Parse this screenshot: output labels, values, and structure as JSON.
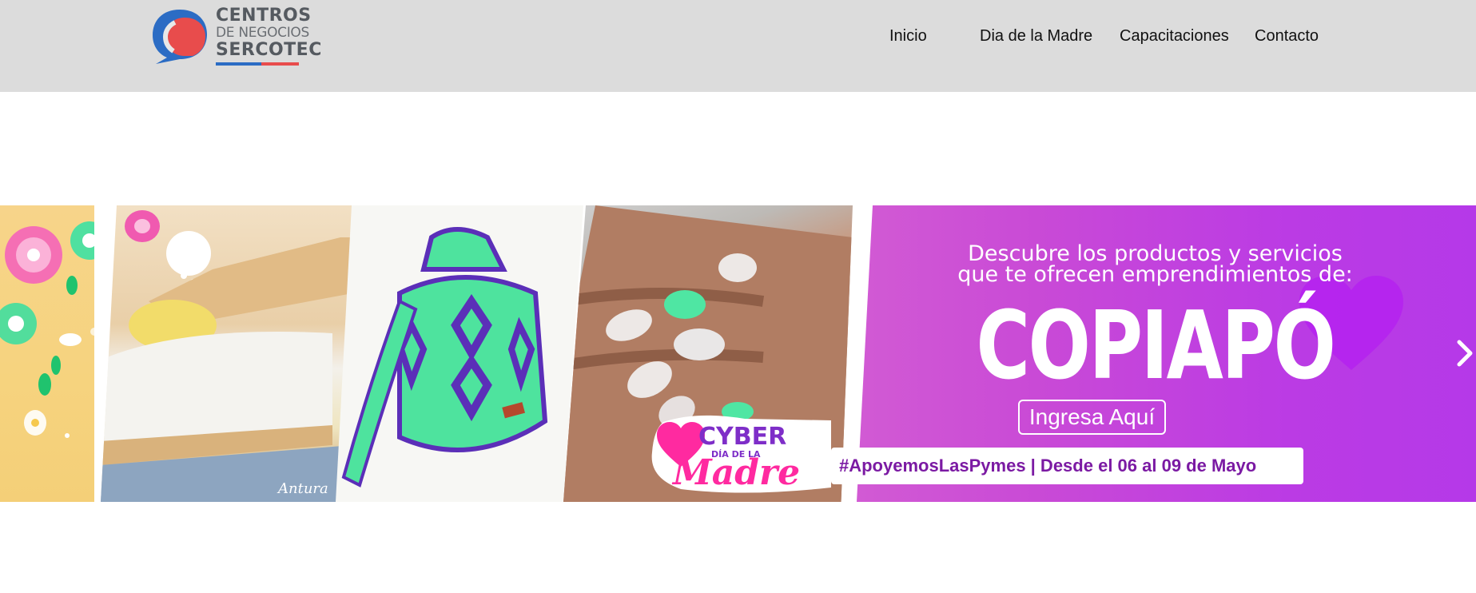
{
  "header": {
    "logo": {
      "line1": "CENTROS",
      "line2": "DE NEGOCIOS",
      "line3": "SERCOTEC",
      "icon": "speech-bubble-logo-icon",
      "colors": {
        "blue": "#2b6cc4",
        "red": "#e84c4c",
        "gray": "#555a60"
      }
    },
    "nav": [
      {
        "label": "Inicio"
      },
      {
        "label": "Dia de la Madre"
      },
      {
        "label": "Capacitaciones"
      },
      {
        "label": "Contacto"
      }
    ],
    "background": "#dcdcdc"
  },
  "banner": {
    "promo": {
      "line1": "Descubre los productos y servicios",
      "line2": "que te ofrecen emprendimientos de:",
      "city": "COPIAPÓ",
      "cta": "Ingresa Aquí",
      "background": "#c94ad6"
    },
    "badge": {
      "cyber": "CYBER",
      "sub": "DÍA DE LA",
      "madre": "Madre"
    },
    "hashtag": "#ApoyemosLasPymes | Desde el 06 al 09 de Mayo",
    "signature": "Antura",
    "next_arrow_icon": "chevron-right-icon"
  }
}
